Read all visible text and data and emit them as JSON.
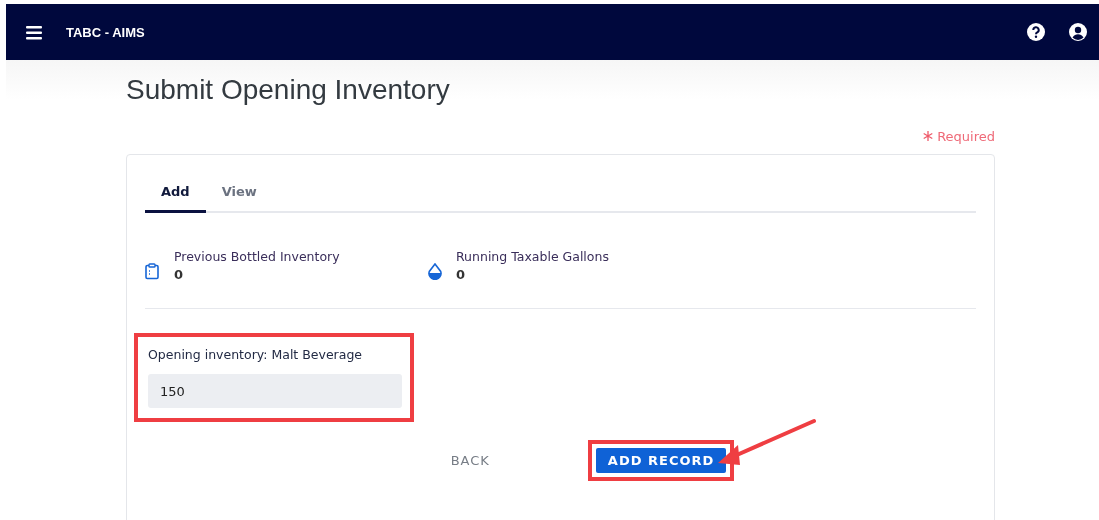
{
  "navbar": {
    "title": "TABC - AIMS"
  },
  "page": {
    "title": "Submit Opening Inventory",
    "required_note": "Required"
  },
  "tabs": [
    {
      "label": "Add",
      "selected": true
    },
    {
      "label": "View",
      "selected": false
    }
  ],
  "stats": [
    {
      "kind": "clipboard",
      "label": "Previous Bottled Inventory",
      "value": "0"
    },
    {
      "kind": "drop",
      "label": "Running Taxable Gallons",
      "value": "0"
    }
  ],
  "field": {
    "label": "Opening inventory: Malt Beverage",
    "value": "150",
    "highlighted": true
  },
  "buttons": [
    {
      "kind": "text",
      "label": "BACK",
      "highlighted": false
    },
    {
      "kind": "primary",
      "label": "ADD RECORD",
      "highlighted": true
    }
  ],
  "annotation_arrow": {
    "shown": true
  }
}
